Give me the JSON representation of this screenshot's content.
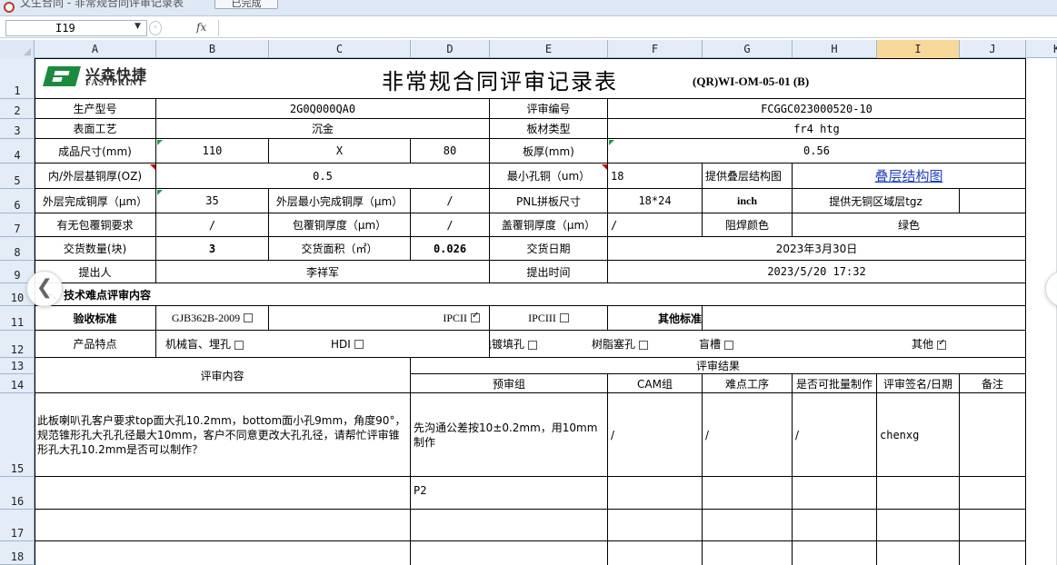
{
  "window": {
    "title": "文生合同 - 非常规合同评审记录表",
    "ok_label": "已完成"
  },
  "formula_bar": {
    "name_box": "I19",
    "fx": "fx",
    "formula": ""
  },
  "columns": [
    "A",
    "B",
    "C",
    "D",
    "E",
    "F",
    "G",
    "H",
    "I",
    "J",
    "K"
  ],
  "selected_column": "I",
  "rows": [
    "1",
    "2",
    "3",
    "4",
    "5",
    "6",
    "7",
    "8",
    "9",
    "10",
    "11",
    "12",
    "13",
    "14",
    "15",
    "16",
    "17",
    "18"
  ],
  "header": {
    "logo_cn": "兴森快捷",
    "logo_en": "FASTPRINT",
    "title": "非常规合同评审记录表",
    "form_code": "(QR)WI-OM-05-01 (B)"
  },
  "r2": {
    "a": "生产型号",
    "b": "2G0Q000QA0",
    "e": "评审编号",
    "f": "FCGGC023000520-10"
  },
  "r3": {
    "a": "表面工艺",
    "b": "沉金",
    "e": "板材类型",
    "f": "fr4 htg"
  },
  "r4": {
    "a": "成品尺寸(mm)",
    "b": "110",
    "c": "X",
    "d": "80",
    "e": "板厚(mm)",
    "f": "0.56"
  },
  "r5": {
    "a": "内/外层基铜厚(OZ)",
    "b": "0.5",
    "e": "最小孔铜（um）",
    "f": "18",
    "g": "提供叠层结构图",
    "h": "叠层结构图"
  },
  "r6": {
    "a": "外层完成铜厚（μm）",
    "b": "35",
    "c": "外层最小完成铜厚（μm）",
    "d": "/",
    "e": "PNL拼板尺寸",
    "f": "18*24",
    "g": "inch",
    "h": "提供无铜区域层tgz"
  },
  "r7": {
    "a": "有无包覆铜要求",
    "b": "/",
    "c": "包覆铜厚度（μm）",
    "d": "/",
    "e": "盖覆铜厚度（μm）",
    "f": "/",
    "g": "阻焊颜色",
    "h": "绿色"
  },
  "r8": {
    "a": "交货数量(块)",
    "b": "3",
    "c": "交货面积（㎡）",
    "d": "0.026",
    "e": "交货日期",
    "f": "2023年3月30日"
  },
  "r9": {
    "a": "提出人",
    "b": "李祥军",
    "e": "提出时间",
    "f": "2023/5/20 17:32"
  },
  "r10": {
    "a": "一、技术难点评审内容"
  },
  "r11": {
    "a": "验收标准",
    "b": "GJB362B-2009",
    "c": "IPCII",
    "d": "IPCIII",
    "f": "其他标准"
  },
  "r12": {
    "a": "产品特点",
    "b": "机械盲、埋孔",
    "c": "HDI",
    "d": "电镀填孔",
    "f": "树脂塞孔",
    "g": "盲槽",
    "j": "其他"
  },
  "checkboxes": {
    "gjb": false,
    "ipc2": true,
    "ipc3": false,
    "mech": false,
    "hdi": false,
    "plating": false,
    "resin": false,
    "slot": false,
    "other": true
  },
  "r13": {
    "a": "评审内容",
    "d": "评审结果"
  },
  "r14": {
    "d": "预审组",
    "f": "CAM组",
    "g": "难点工序",
    "h": "是否可批量制作",
    "i": "评审签名/日期",
    "j": "备注"
  },
  "r15": {
    "a": "此板喇叭孔客户要求top面大孔10.2mm，bottom面小孔9mm，角度90°，规范锥形孔大孔孔径最大10mm，客户不同意更改大孔孔径，请帮忙评审锥形孔大孔10.2mm是否可以制作？",
    "d": "先沟通公差按10±0.2mm，用10mm制作",
    "f": "/",
    "g": "/",
    "h": "/",
    "i": "chenxg"
  },
  "r16": {
    "d": "P2"
  }
}
